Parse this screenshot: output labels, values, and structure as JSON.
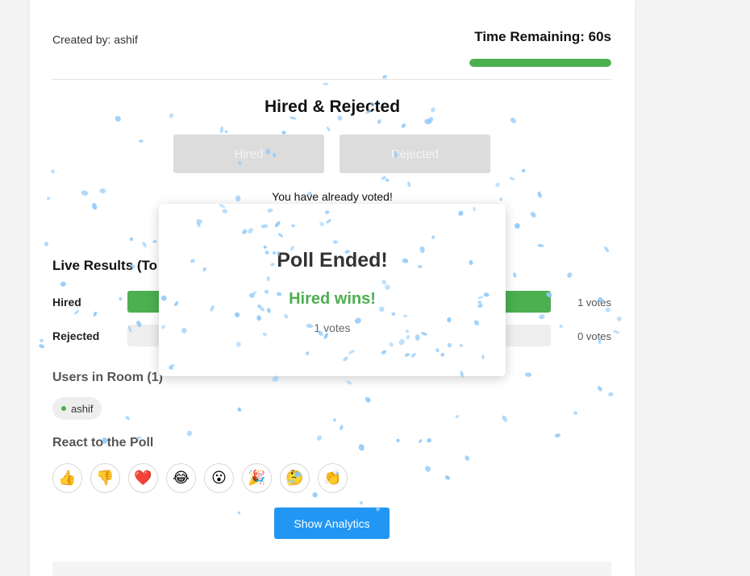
{
  "poll": {
    "created_by": "Created by: ashif",
    "time_remaining": "Time Remaining: 60s",
    "time_fraction": 1.0,
    "title": "Hired & Rejected",
    "options": [
      "Hired",
      "Rejected"
    ],
    "voted_message": "You have already voted!"
  },
  "results": {
    "heading": "Live Results (To",
    "rows": [
      {
        "label": "Hired",
        "votes_text": "1 votes",
        "fraction": 1.0
      },
      {
        "label": "Rejected",
        "votes_text": "0 votes",
        "fraction": 0.0
      }
    ]
  },
  "users": {
    "heading": "Users in Room (1)",
    "list": [
      {
        "name": "ashif",
        "status": "online"
      }
    ]
  },
  "reactions": {
    "heading": "React to the Poll",
    "items": [
      {
        "glyph": "👍",
        "icon": "thumbs-up-icon"
      },
      {
        "glyph": "👎",
        "icon": "thumbs-down-icon"
      },
      {
        "glyph": "❤️",
        "icon": "heart-icon"
      },
      {
        "glyph": "😂",
        "icon": "laughing-icon"
      },
      {
        "glyph": "😮",
        "icon": "surprised-icon"
      },
      {
        "glyph": "🎉",
        "icon": "party-popper-icon"
      },
      {
        "glyph": "🤔",
        "icon": "thinking-icon"
      },
      {
        "glyph": "👏",
        "icon": "clapping-icon"
      }
    ]
  },
  "actions": {
    "show_analytics": "Show Analytics"
  },
  "modal": {
    "title": "Poll Ended!",
    "winner": "Hired wins!",
    "votes": "1 votes"
  },
  "colors": {
    "accent_green": "#4caf50",
    "primary_blue": "#2196f3",
    "confetti_blue": "#90caf9"
  }
}
